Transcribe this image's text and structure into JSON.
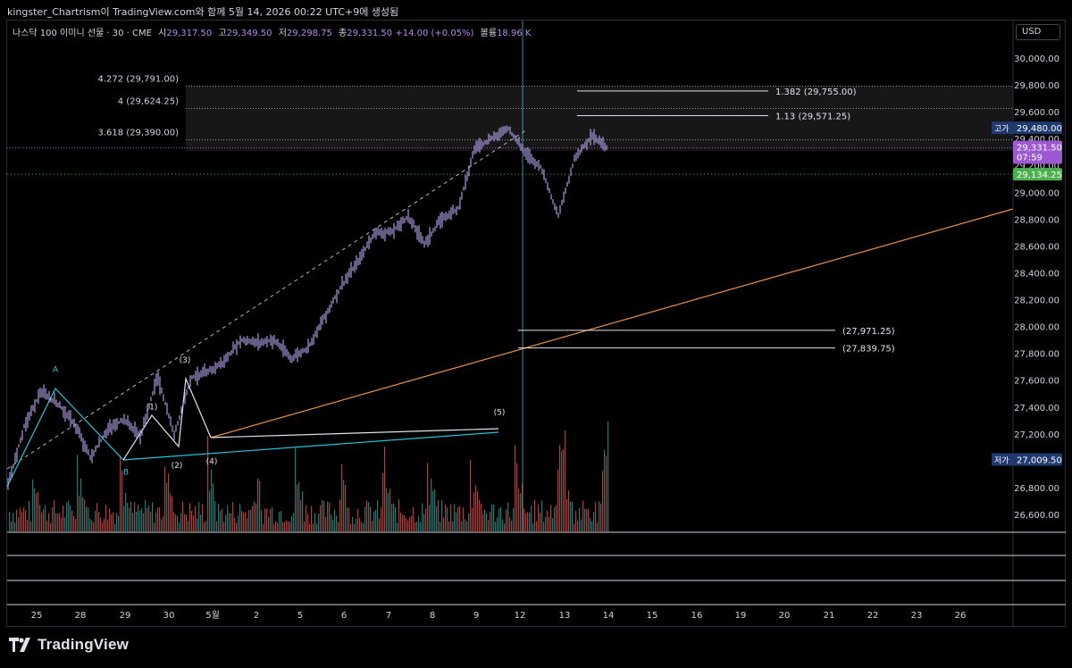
{
  "caption": "kingster_Chartrism이 TradingView.com와 함께 5월 14, 2026 00:22 UTC+9에 생성됨",
  "legend": {
    "symbol": "나스닥 100 이미니 선물 · 30 · CME",
    "open_label": "시",
    "open": "29,317.50",
    "high_label": "고",
    "high": "29,349.50",
    "low_label": "저",
    "low": "29,298.75",
    "close_label": "종",
    "close": "29,331.50",
    "change": "+14.00 (+0.05%)",
    "volume_label": "볼륨",
    "volume": "18.96 K"
  },
  "currency_button": "USD",
  "brand": "TradingView",
  "colors": {
    "background": "#000000",
    "axis_text": "#d1d4dc",
    "up_bar": "#b8a9f0",
    "volume_up": "#26a69a",
    "volume_down": "#ef5350",
    "trendline": "#e8914b",
    "crosshair": "#4dd0e1",
    "price_tag": "#9c59d1",
    "green_tag": "#4caf50",
    "high_low_tag": "#1e3a6e"
  },
  "chart_data": {
    "type": "candlestick",
    "y_axis": {
      "ticks": [
        "30,000.00",
        "29,800.00",
        "29,600.00",
        "29,400.00",
        "29,200.00",
        "29,000.00",
        "28,800.00",
        "28,600.00",
        "28,400.00",
        "28,200.00",
        "28,000.00",
        "27,800.00",
        "27,600.00",
        "27,400.00",
        "27,200.00",
        "27,000.00",
        "26,800.00",
        "26,600.00"
      ],
      "range": [
        26520,
        30100
      ]
    },
    "x_axis": {
      "ticks": [
        "25",
        "28",
        "29",
        "30",
        "5월",
        "2",
        "5",
        "6",
        "7",
        "8",
        "9",
        "12",
        "13",
        "14",
        "15",
        "16",
        "19",
        "20",
        "21",
        "22",
        "23",
        "26"
      ]
    },
    "price_path": [
      [
        0,
        26790
      ],
      [
        1,
        27250
      ],
      [
        2,
        27510
      ],
      [
        3,
        27430
      ],
      [
        4,
        27280
      ],
      [
        5,
        27020
      ],
      [
        6,
        27230
      ],
      [
        7,
        27310
      ],
      [
        8,
        27180
      ],
      [
        9,
        27630
      ],
      [
        10,
        27190
      ],
      [
        11,
        27620
      ],
      [
        12,
        27660
      ],
      [
        13,
        27740
      ],
      [
        14,
        27900
      ],
      [
        15,
        27880
      ],
      [
        16,
        27900
      ],
      [
        17,
        27760
      ],
      [
        18,
        27840
      ],
      [
        19,
        28070
      ],
      [
        20,
        28300
      ],
      [
        21,
        28480
      ],
      [
        22,
        28700
      ],
      [
        23,
        28700
      ],
      [
        24,
        28820
      ],
      [
        25,
        28620
      ],
      [
        26,
        28800
      ],
      [
        27,
        28880
      ],
      [
        28,
        29330
      ],
      [
        29,
        29400
      ],
      [
        30,
        29480
      ],
      [
        31,
        29300
      ],
      [
        32,
        29180
      ],
      [
        33,
        28820
      ],
      [
        34,
        29260
      ],
      [
        35,
        29420
      ],
      [
        36,
        29330
      ]
    ],
    "last_price": "29,331.50",
    "countdown": "07:59",
    "green_level": "29,134.25",
    "high_tag_label": "고가",
    "high_tag": "29,480.00",
    "low_tag_label": "저가",
    "low_tag": "27,009.50",
    "fib_levels": [
      {
        "label": "4.272 (29,791.00)",
        "value": 29791.0
      },
      {
        "label": "4 (29,624.25)",
        "value": 29624.25
      },
      {
        "label": "3.618 (29,390.00)",
        "value": 29390.0
      }
    ],
    "target_levels": [
      {
        "label": "1.382 (29,755.00)",
        "value": 29755.0
      },
      {
        "label": "1.13 (29,571.25)",
        "value": 29571.25
      },
      {
        "label": "(27,971.25)",
        "value": 27971.25
      },
      {
        "label": "(27,839.75)",
        "value": 27839.75
      }
    ],
    "wave_labels": [
      {
        "text": "A",
        "price": 27580
      },
      {
        "text": "B",
        "price": 26990
      },
      {
        "text": "(1)",
        "price": 27330
      },
      {
        "text": "(2)",
        "price": 27040
      },
      {
        "text": "(3)",
        "price": 27650
      },
      {
        "text": "(4)",
        "price": 27070
      },
      {
        "text": "(5)",
        "price": 27290
      }
    ]
  }
}
